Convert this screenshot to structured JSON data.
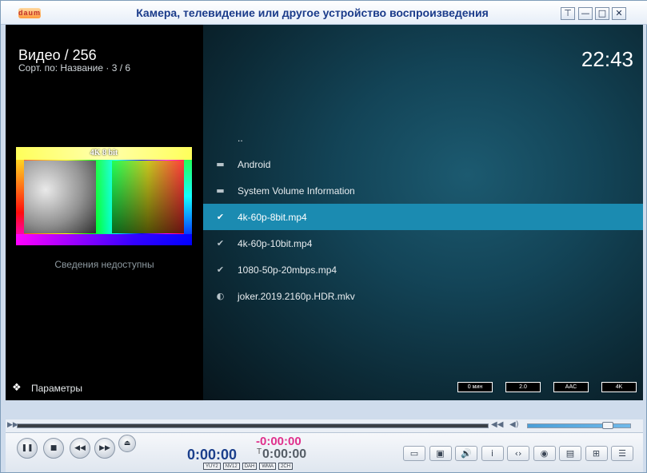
{
  "window": {
    "logo": "daum",
    "title": "Камера, телевидение или другое устройство воспроизведения",
    "buttons": {
      "skin": "⊤",
      "minimize": "—",
      "maximize": "□",
      "close": "✕"
    }
  },
  "kodi": {
    "section_title": "Видео / 256",
    "sort_info": "Сорт. по: Название  ·  3 / 6",
    "clock": "22:43",
    "thumbnail_caption": "4K 8 bit",
    "no_info": "Сведения недоступны",
    "options_label": "Параметры",
    "files": [
      {
        "icon": "parent",
        "glyph": "··",
        "label": "..",
        "selected": false
      },
      {
        "icon": "folder-icon",
        "glyph": "▬",
        "label": "Android",
        "selected": false
      },
      {
        "icon": "folder-icon",
        "glyph": "▬",
        "label": "System Volume Information",
        "selected": false
      },
      {
        "icon": "check-icon",
        "glyph": "✔",
        "label": "4k-60p-8bit.mp4",
        "selected": true
      },
      {
        "icon": "check-icon",
        "glyph": "✔",
        "label": "4k-60p-10bit.mp4",
        "selected": false
      },
      {
        "icon": "check-icon",
        "glyph": "✔",
        "label": "1080-50p-20mbps.mp4",
        "selected": false
      },
      {
        "icon": "half-watched-icon",
        "glyph": "◐",
        "label": "joker.2019.2160p.HDR.mkv",
        "selected": false
      }
    ],
    "badges": [
      "0 мин",
      "2.0",
      "AAC",
      "4K"
    ]
  },
  "player": {
    "time_elapsed": "0:00:00",
    "time_remaining": "-0:00:00",
    "time_total_prefix": "T",
    "time_total": "0:00:00",
    "codecs": [
      "YUY2",
      "NV12",
      "DAH",
      "WMA",
      "2CH"
    ],
    "seek_progress": 0,
    "volume_level": 0.78,
    "transport": {
      "pause": "❚❚",
      "stop": "■",
      "prev": "◀◀",
      "next": "▶▶",
      "eject": "⏏"
    },
    "side_buttons": [
      "▭",
      "▣",
      "🔊",
      "i",
      "‹›",
      "◉",
      "▤",
      "⊞",
      "☰"
    ]
  }
}
